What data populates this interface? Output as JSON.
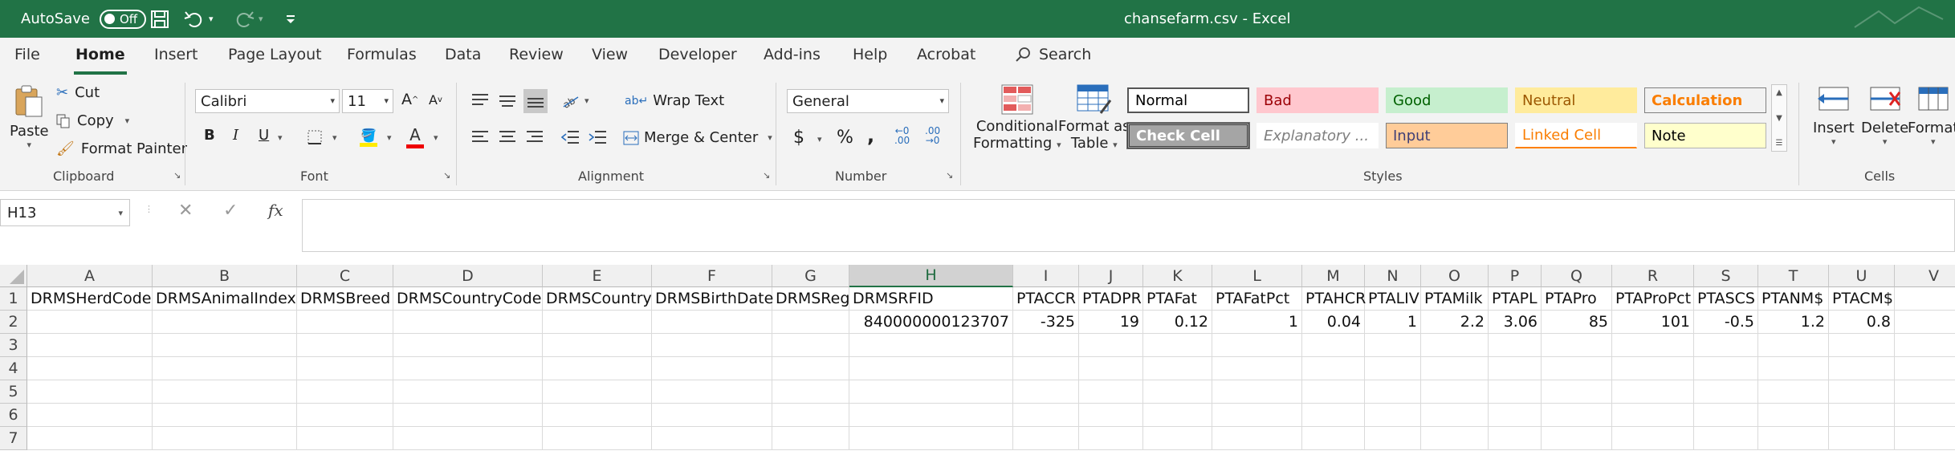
{
  "titlebar": {
    "autosave_label": "AutoSave",
    "autosave_state": "Off",
    "title": "chansefarm.csv  -  Excel"
  },
  "tabs": [
    "File",
    "Home",
    "Insert",
    "Page Layout",
    "Formulas",
    "Data",
    "Review",
    "View",
    "Developer",
    "Add-ins",
    "Help",
    "Acrobat"
  ],
  "search_label": "Search",
  "clipboard": {
    "paste": "Paste",
    "cut": "Cut",
    "copy": "Copy",
    "format_painter": "Format Painter",
    "group": "Clipboard"
  },
  "font": {
    "name": "Calibri",
    "size": "11",
    "bold": "B",
    "italic": "I",
    "underline": "U",
    "group": "Font"
  },
  "alignment": {
    "wrap_text": "Wrap Text",
    "merge_center": "Merge & Center",
    "group": "Alignment"
  },
  "number": {
    "format": "General",
    "group": "Number"
  },
  "styles": {
    "conditional_formatting": [
      "Conditional",
      "Formatting"
    ],
    "format_as_table": [
      "Format as",
      "Table"
    ],
    "cells": [
      {
        "label": "Normal",
        "bg": "#ffffff",
        "fg": "#000000"
      },
      {
        "label": "Bad",
        "bg": "#ffc7ce",
        "fg": "#9c0006"
      },
      {
        "label": "Good",
        "bg": "#c6efce",
        "fg": "#006100"
      },
      {
        "label": "Neutral",
        "bg": "#ffeb9c",
        "fg": "#9c5700"
      },
      {
        "label": "Calculation",
        "bg": "#f2f2f2",
        "fg": "#fa7d00"
      },
      {
        "label": "Check Cell",
        "bg": "#a5a5a5",
        "fg": "#ffffff"
      },
      {
        "label": "Explanatory ...",
        "bg": "#ffffff",
        "fg": "#7f7f7f"
      },
      {
        "label": "Input",
        "bg": "#ffcc99",
        "fg": "#3f3f76"
      },
      {
        "label": "Linked Cell",
        "bg": "#ffffff",
        "fg": "#fa7d00"
      },
      {
        "label": "Note",
        "bg": "#ffffcc",
        "fg": "#000000"
      }
    ],
    "group": "Styles"
  },
  "cells_group": {
    "insert": "Insert",
    "delete": "Delete",
    "format": "Format",
    "group": "Cells"
  },
  "formula_bar": {
    "name_box": "H13",
    "fx": "fx",
    "content": ""
  },
  "sheet": {
    "columns": [
      "A",
      "B",
      "C",
      "D",
      "E",
      "F",
      "G",
      "H",
      "I",
      "J",
      "K",
      "L",
      "M",
      "N",
      "O",
      "P",
      "Q",
      "R",
      "S",
      "T",
      "U",
      "V"
    ],
    "selected_column": "H",
    "row_numbers": [
      "1",
      "2",
      "3",
      "4",
      "5",
      "6",
      "7"
    ],
    "header_row": [
      "DRMSHerdCode",
      "DRMSAnimalIndex",
      "DRMSBreed",
      "DRMSCountryCode",
      "DRMSCountry",
      "DRMSBirthDate",
      "DRMSReg",
      "DRMSRFID",
      "PTACCR",
      "PTADPR",
      "PTAFat",
      "PTAFatPct",
      "PTAHCR",
      "PTALIV",
      "PTAMilk",
      "PTAPL",
      "PTAPro",
      "PTAProPct",
      "PTASCS",
      "PTANM$",
      "PTACM$",
      ""
    ],
    "data_row": [
      "",
      "",
      "",
      "",
      "",
      "",
      "",
      "840000000123707",
      "-325",
      "19",
      "0.12",
      "1",
      "0.04",
      "1",
      "2.2",
      "3.06",
      "85",
      "101",
      "-0.5",
      "1.2",
      "0.8",
      ""
    ]
  }
}
